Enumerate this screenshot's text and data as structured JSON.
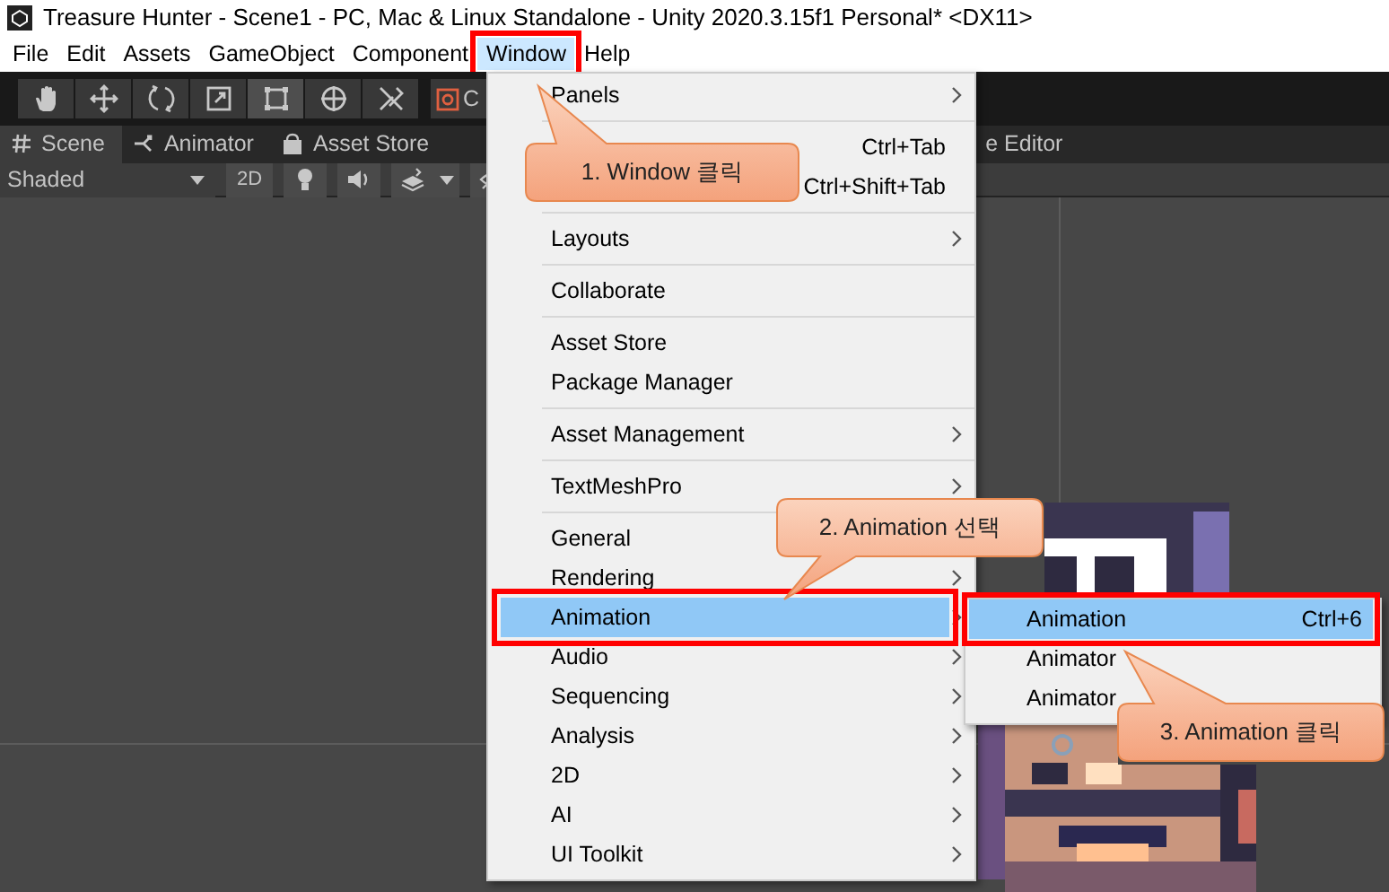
{
  "window": {
    "title": "Treasure Hunter - Scene1 - PC, Mac & Linux Standalone - Unity 2020.3.15f1 Personal* <DX11>"
  },
  "menu_bar": [
    {
      "label": "File",
      "selected": false
    },
    {
      "label": "Edit",
      "selected": false
    },
    {
      "label": "Assets",
      "selected": false
    },
    {
      "label": "GameObject",
      "selected": false
    },
    {
      "label": "Component",
      "selected": false
    },
    {
      "label": "Window",
      "selected": true
    },
    {
      "label": "Help",
      "selected": false
    }
  ],
  "toolbar": {
    "tools": [
      {
        "kind": "hand",
        "selected": false
      },
      {
        "kind": "move",
        "selected": false
      },
      {
        "kind": "rotate",
        "selected": false
      },
      {
        "kind": "scale",
        "selected": false
      },
      {
        "kind": "rect",
        "selected": true
      },
      {
        "kind": "transform",
        "selected": false
      },
      {
        "kind": "custom",
        "selected": false
      }
    ],
    "pivot_button": {
      "label": "C"
    }
  },
  "tabs": [
    {
      "kind": "scene",
      "label": "Scene",
      "selected": true
    },
    {
      "kind": "animator",
      "label": "Animator",
      "selected": false
    },
    {
      "kind": "store",
      "label": "Asset Store",
      "selected": false
    },
    {
      "kind": "plain",
      "label": "e Editor",
      "selected": false
    }
  ],
  "scene_toolbar": {
    "shading": "Shaded",
    "mode_2d": "2D"
  },
  "window_menu": {
    "groups": [
      [
        {
          "label": "Panels",
          "submenu": true,
          "selected": false
        }
      ],
      [
        {
          "shortcut": "Ctrl+Tab",
          "submenu": false,
          "selected": false
        },
        {
          "shortcut": "Ctrl+Shift+Tab",
          "submenu": false,
          "selected": false
        }
      ],
      [
        {
          "label": "Layouts",
          "submenu": true,
          "selected": false
        }
      ],
      [
        {
          "label": "Collaborate",
          "submenu": false,
          "selected": false
        }
      ],
      [
        {
          "label": "Asset Store",
          "submenu": false,
          "selected": false
        },
        {
          "label": "Package Manager",
          "submenu": false,
          "selected": false
        }
      ],
      [
        {
          "label": "Asset Management",
          "submenu": true,
          "selected": false
        }
      ],
      [
        {
          "label": "TextMeshPro",
          "submenu": true,
          "selected": false
        }
      ],
      [
        {
          "label": "General",
          "submenu": false,
          "selected": false
        },
        {
          "label": "Rendering",
          "submenu": true,
          "selected": false
        },
        {
          "label": "Animation",
          "submenu": true,
          "selected": true
        },
        {
          "label": "Audio",
          "submenu": true,
          "selected": false
        },
        {
          "label": "Sequencing",
          "submenu": true,
          "selected": false
        },
        {
          "label": "Analysis",
          "submenu": true,
          "selected": false
        },
        {
          "label": "2D",
          "submenu": true,
          "selected": false
        },
        {
          "label": "AI",
          "submenu": true,
          "selected": false
        },
        {
          "label": "UI Toolkit",
          "submenu": true,
          "selected": false
        }
      ]
    ]
  },
  "animation_submenu": {
    "items": [
      {
        "label": "Animation",
        "shortcut": "Ctrl+6",
        "selected": true
      },
      {
        "label": "Animator",
        "selected": false
      },
      {
        "label": "Animator",
        "selected": false
      }
    ]
  },
  "callouts": [
    {
      "text": "1. Window 클릭"
    },
    {
      "text": "2. Animation 선택"
    },
    {
      "text": "3. Animation 클릭"
    }
  ]
}
